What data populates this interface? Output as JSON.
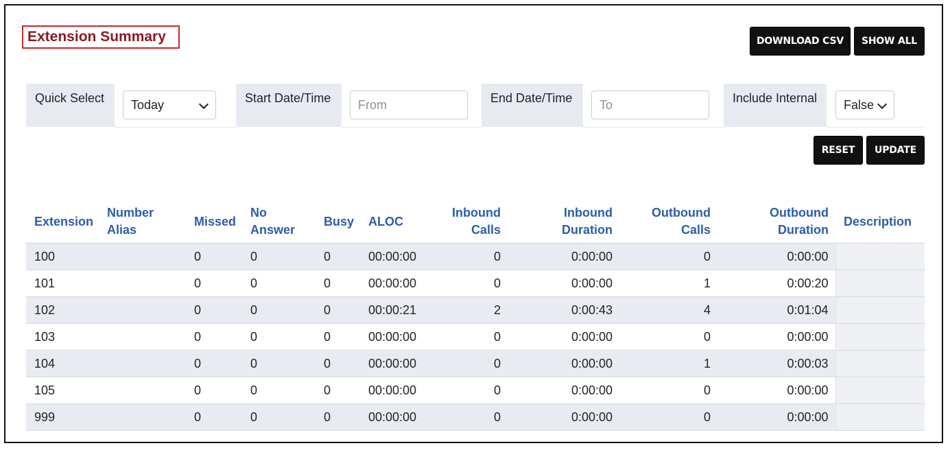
{
  "page": {
    "title": "Extension Summary",
    "download_csv_label": "DOWNLOAD CSV",
    "show_all_label": "SHOW ALL",
    "reset_label": "RESET",
    "update_label": "UPDATE"
  },
  "filters": {
    "quick_select_label": "Quick Select",
    "quick_select_value": "Today",
    "start_label": "Start Date/Time",
    "start_placeholder": "From",
    "end_label": "End Date/Time",
    "end_placeholder": "To",
    "include_internal_label": "Include Internal",
    "include_internal_value": "False"
  },
  "table": {
    "columns": [
      "Extension",
      "Number\nAlias",
      "Missed",
      "No\nAnswer",
      "Busy",
      "ALOC",
      "Inbound\nCalls",
      "Inbound\nDuration",
      "Outbound\nCalls",
      "Outbound\nDuration",
      "Description"
    ],
    "rows": [
      [
        "100",
        "",
        "0",
        "0",
        "0",
        "00:00:00",
        "0",
        "0:00:00",
        "0",
        "0:00:00",
        ""
      ],
      [
        "101",
        "",
        "0",
        "0",
        "0",
        "00:00:00",
        "0",
        "0:00:00",
        "1",
        "0:00:20",
        ""
      ],
      [
        "102",
        "",
        "0",
        "0",
        "0",
        "00:00:21",
        "2",
        "0:00:43",
        "4",
        "0:01:04",
        ""
      ],
      [
        "103",
        "",
        "0",
        "0",
        "0",
        "00:00:00",
        "0",
        "0:00:00",
        "0",
        "0:00:00",
        ""
      ],
      [
        "104",
        "",
        "0",
        "0",
        "0",
        "00:00:00",
        "0",
        "0:00:00",
        "1",
        "0:00:03",
        ""
      ],
      [
        "105",
        "",
        "0",
        "0",
        "0",
        "00:00:00",
        "0",
        "0:00:00",
        "0",
        "0:00:00",
        ""
      ],
      [
        "999",
        "",
        "0",
        "0",
        "0",
        "00:00:00",
        "0",
        "0:00:00",
        "0",
        "0:00:00",
        ""
      ]
    ]
  }
}
